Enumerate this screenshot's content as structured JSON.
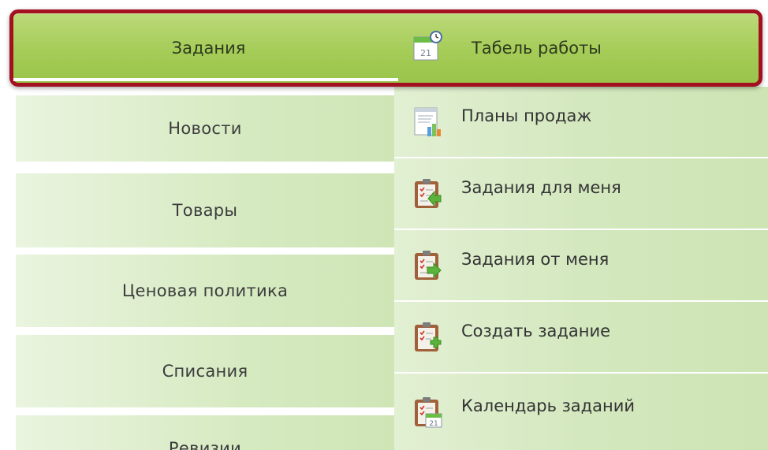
{
  "left_nav": {
    "active_label": "Задания",
    "items": [
      {
        "label": "Новости"
      },
      {
        "label": "Товары"
      },
      {
        "label": "Ценовая политика"
      },
      {
        "label": "Списания"
      },
      {
        "label": "Ревизии"
      }
    ]
  },
  "submenu": {
    "active_item": {
      "label": "Табель работы",
      "icon": "timesheet-calendar-icon"
    },
    "items": [
      {
        "label": "Планы продаж",
        "icon": "sales-plan-chart-icon"
      },
      {
        "label": "Задания для меня",
        "icon": "task-incoming-icon"
      },
      {
        "label": "Задания от меня",
        "icon": "task-outgoing-icon"
      },
      {
        "label": "Создать задание",
        "icon": "task-create-icon"
      },
      {
        "label": "Календарь заданий",
        "icon": "task-calendar-icon"
      }
    ]
  },
  "colors": {
    "highlight_border": "#a31020",
    "active_green": "#a5cc57",
    "item_green": "#d4e8bf"
  }
}
